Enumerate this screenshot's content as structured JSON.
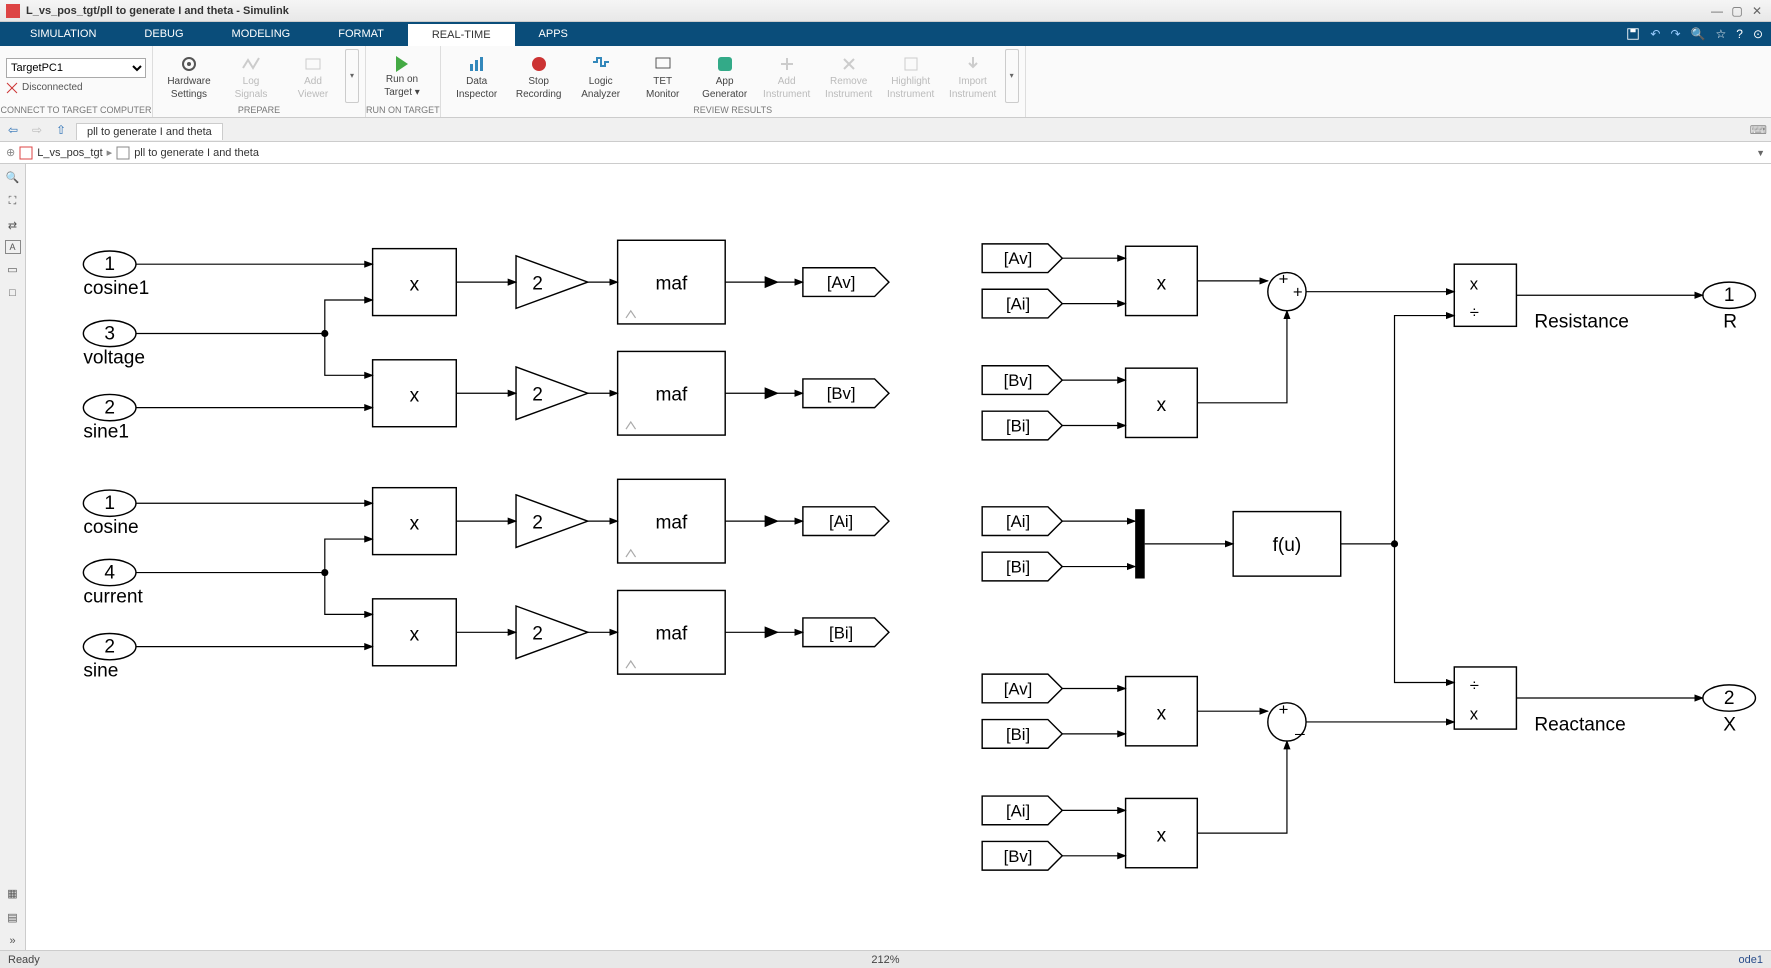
{
  "title": "L_vs_pos_tgt/pll to generate I and theta - Simulink",
  "tabs": [
    "SIMULATION",
    "DEBUG",
    "MODELING",
    "FORMAT",
    "REAL-TIME",
    "APPS"
  ],
  "active_tab": "REAL-TIME",
  "target": {
    "selected": "TargetPC1",
    "status": "Disconnected",
    "group_label": "CONNECT TO TARGET COMPUTER"
  },
  "ribbon": {
    "prepare": {
      "label": "PREPARE",
      "hw": {
        "l1": "Hardware",
        "l2": "Settings"
      },
      "log": {
        "l1": "Log",
        "l2": "Signals"
      },
      "viewer": {
        "l1": "Add",
        "l2": "Viewer"
      }
    },
    "run": {
      "label": "RUN ON TARGET",
      "btn": {
        "l1": "Run on",
        "l2": "Target ▾"
      }
    },
    "review": {
      "label": "REVIEW RESULTS",
      "di": {
        "l1": "Data",
        "l2": "Inspector"
      },
      "sr": {
        "l1": "Stop",
        "l2": "Recording"
      },
      "la": {
        "l1": "Logic",
        "l2": "Analyzer"
      },
      "tet": {
        "l1": "TET",
        "l2": "Monitor"
      },
      "app": {
        "l1": "App",
        "l2": "Generator"
      },
      "ai": {
        "l1": "Add",
        "l2": "Instrument"
      },
      "ri": {
        "l1": "Remove",
        "l2": "Instrument"
      },
      "hi": {
        "l1": "Highlight",
        "l2": "Instrument"
      },
      "ii": {
        "l1": "Import",
        "l2": "Instrument"
      }
    }
  },
  "nav_tab": "pll to generate I and theta",
  "breadcrumb": {
    "root": "L_vs_pos_tgt",
    "leaf": "pll to generate I and theta"
  },
  "status": {
    "left": "Ready",
    "zoom": "212%",
    "solver": "ode1"
  },
  "blocks": {
    "in_cosine1": {
      "num": "1",
      "label": "cosine1"
    },
    "in_voltage": {
      "num": "3",
      "label": "voltage"
    },
    "in_sine1": {
      "num": "2",
      "label": "sine1"
    },
    "in_cosine": {
      "num": "1",
      "label": "cosine"
    },
    "in_current": {
      "num": "4",
      "label": "current"
    },
    "in_sine": {
      "num": "2",
      "label": "sine"
    },
    "gain": "2",
    "maf": "maf",
    "goto_Av": "[Av]",
    "goto_Bv": "[Bv]",
    "goto_Ai": "[Ai]",
    "goto_Bi": "[Bi]",
    "from_Av": "[Av]",
    "from_Ai": "[Ai]",
    "from_Bv": "[Bv]",
    "from_Bi": "[Bi]",
    "fcn": "f(u)",
    "out_R": {
      "num": "1",
      "label": "R",
      "name": "Resistance"
    },
    "out_X": {
      "num": "2",
      "label": "X",
      "name": "Reactance"
    },
    "mult": "x",
    "div": "÷"
  }
}
